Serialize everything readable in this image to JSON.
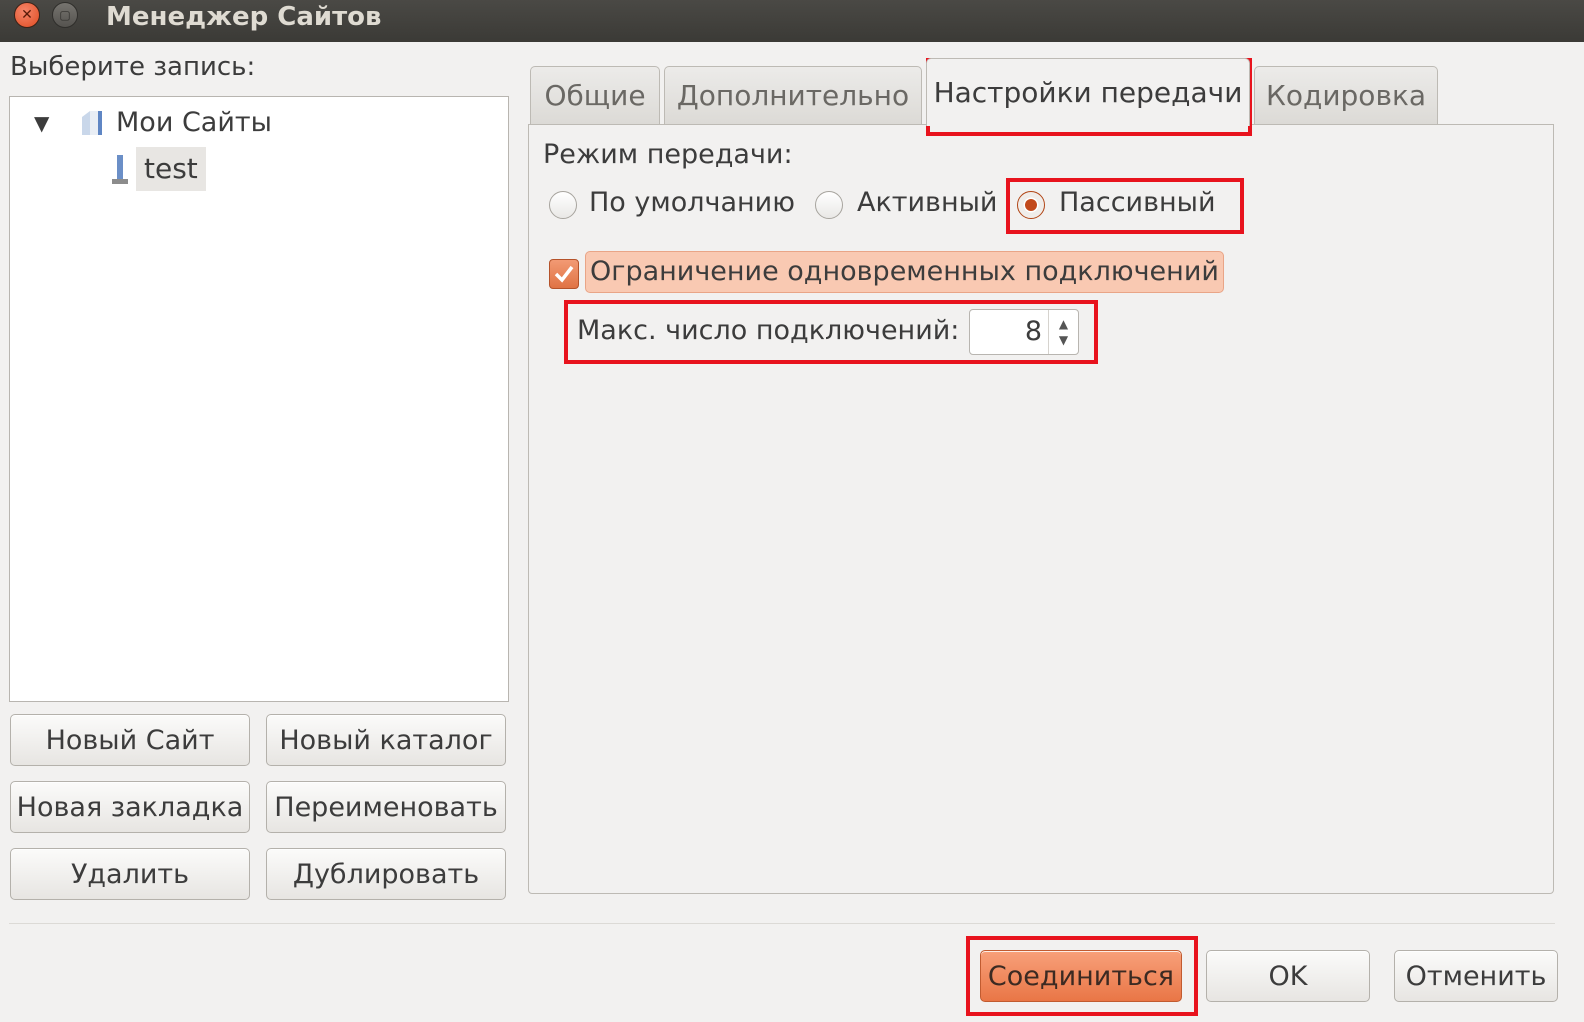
{
  "window": {
    "title": "Менеджер Сайтов"
  },
  "left": {
    "select_label": "Выберите запись:",
    "tree": {
      "root_label": "Мои Сайты",
      "children": [
        "test"
      ]
    },
    "buttons": {
      "new_site": "Новый Сайт",
      "new_folder": "Новый каталог",
      "new_bookmark": "Новая закладка",
      "rename": "Переименовать",
      "delete": "Удалить",
      "duplicate": "Дублировать"
    }
  },
  "tabs": [
    {
      "label": "Общие",
      "active": false
    },
    {
      "label": "Дополнительно",
      "active": false
    },
    {
      "label": "Настройки передачи",
      "active": true
    },
    {
      "label": "Кодировка",
      "active": false
    }
  ],
  "transfer": {
    "mode_label": "Режим передачи:",
    "modes": [
      {
        "label": "По умолчанию",
        "checked": false
      },
      {
        "label": "Активный",
        "checked": false
      },
      {
        "label": "Пассивный",
        "checked": true
      }
    ],
    "limit_label": "Ограничение одновременных подключений",
    "limit_checked": true,
    "max_label": "Макс. число подключений:",
    "max_value": "8"
  },
  "footer": {
    "connect": "Соединиться",
    "ok": "OK",
    "cancel": "Отменить"
  },
  "colors": {
    "accent": "#e97646",
    "highlight": "#e8131d",
    "titlebar": "#3b3a36"
  }
}
